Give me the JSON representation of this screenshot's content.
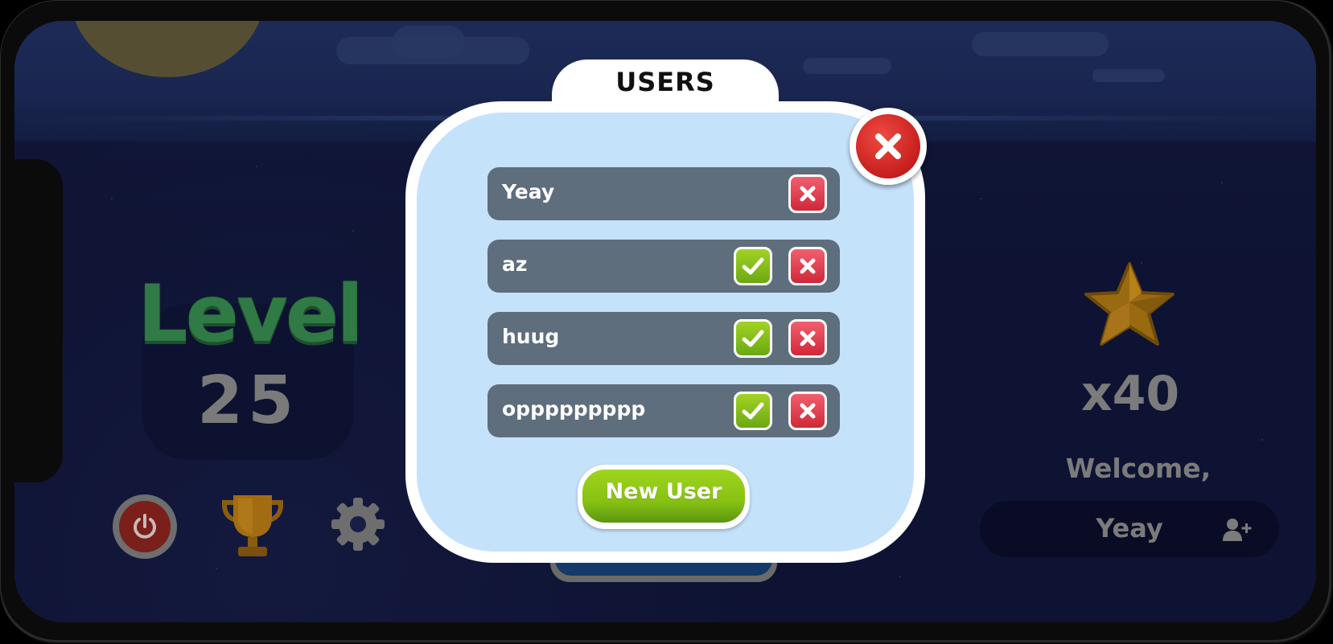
{
  "modal": {
    "title": "USERS",
    "new_user_label": "New User",
    "users": [
      {
        "name": "Yeay",
        "selectable": false
      },
      {
        "name": "az",
        "selectable": true
      },
      {
        "name": "huug",
        "selectable": true
      },
      {
        "name": "oppppppppp",
        "selectable": true
      }
    ]
  },
  "level": {
    "word": "Level",
    "number": "25"
  },
  "stars": {
    "count_label": "x40"
  },
  "welcome": {
    "text": "Welcome,",
    "user_name": "Yeay"
  },
  "icons": {
    "close": "close-icon",
    "check": "check-icon",
    "delete": "x-icon",
    "power": "power-icon",
    "trophy": "trophy-icon",
    "settings": "gear-icon",
    "star": "star-icon",
    "add_user": "add-user-icon"
  },
  "colors": {
    "modal_background": "#c5e2fb",
    "row_background": "#5f6e7c",
    "confirm_green": "#87c212",
    "delete_red": "#d02838",
    "level_green": "#2f7a45"
  }
}
